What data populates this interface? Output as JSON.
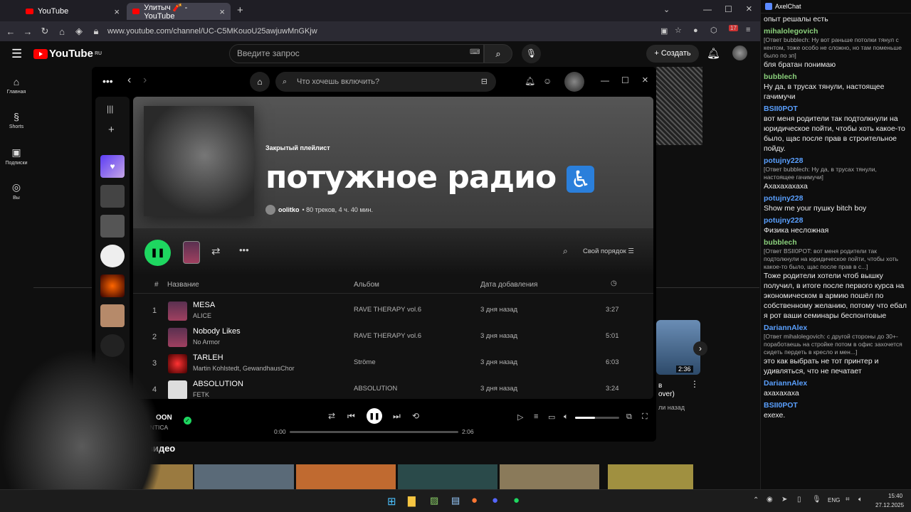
{
  "browser": {
    "tabs": [
      {
        "label": "YouTube"
      },
      {
        "label": "Улитыч 🧨 - YouTube"
      }
    ],
    "url": "www.youtube.com/channel/UC-C5MKouoU25awjuwMnGKjw",
    "notif_count": "17"
  },
  "youtube": {
    "logo": "YouTube",
    "region": "RU",
    "search_placeholder": "Введите запрос",
    "create_label": "Создать",
    "rail": [
      {
        "label": "Главная"
      },
      {
        "label": "Shorts"
      },
      {
        "label": "Подписки"
      },
      {
        "label": "Вы"
      }
    ],
    "section_fragment": "е видео",
    "video_time": "2:36",
    "video_text1": "в",
    "video_text2": "over)",
    "video_text3": "ли назад"
  },
  "spotify": {
    "search_placeholder": "Что хочешь включить?",
    "playlist_type": "Закрытый плейлист",
    "title": "потужное радио",
    "title_emoji": "♿",
    "owner": "oolitko",
    "meta": "• 80 треков, 4 ч. 40 мин.",
    "sort_label": "Свой порядок",
    "headers": {
      "num": "#",
      "title": "Название",
      "album": "Альбом",
      "date": "Дата добавления"
    },
    "tracks": [
      {
        "num": "1",
        "title": "MESA",
        "artist": "ALICE",
        "album": "RAVE THERAPY vol.6",
        "added": "3 дня назад",
        "duration": "3:27"
      },
      {
        "num": "2",
        "title": "Nobody Likes",
        "artist": "No Armor",
        "album": "RAVE THERAPY vol.6",
        "added": "3 дня назад",
        "duration": "5:01"
      },
      {
        "num": "3",
        "title": "TARLEH",
        "artist": "Martin Kohlstedt, GewandhausChor",
        "album": "Ströme",
        "added": "3 дня назад",
        "duration": "6:03"
      },
      {
        "num": "4",
        "title": "ABSOLUTION",
        "artist": "FETK",
        "album": "ABSOLUTION",
        "added": "3 дня назад",
        "duration": "3:24"
      }
    ],
    "now_playing": {
      "title": "OON",
      "artist": "ANTICA",
      "elapsed": "0:00",
      "total": "2:06"
    }
  },
  "chat": {
    "app": "AxelChat",
    "messages": [
      {
        "nick": "",
        "text": "опыт решалы есть",
        "reply": ""
      },
      {
        "nick": "mihalolegovich",
        "text": "бля братан понимаю",
        "reply": "[Ответ bubblech: Ну вот раньше потолки тянул с кентом, тоже особо не сложно, но там поменьше было по зп]"
      },
      {
        "nick": "bubblech",
        "text": "Ну да, в трусах тянули, настоящее гачимучи",
        "reply": ""
      },
      {
        "nick": "BSII0POT",
        "text": "вот меня родители так подтолкнули на юридическое пойти, чтобы хоть какое-то было, щас после прав в строительное пойду.",
        "reply": ""
      },
      {
        "nick": "potujny228",
        "text": "Ахахахахаха",
        "reply": "[Ответ bubblech: Ну да, в трусах тянули, настоящее гачимучи]"
      },
      {
        "nick": "potujny228",
        "text": "Show me your пушку bitch boy",
        "reply": ""
      },
      {
        "nick": "potujny228",
        "text": "Физика несложная",
        "reply": ""
      },
      {
        "nick": "bubblech",
        "text": "Тоже родители хотели чтоб вышку получил, в итоге после первого курса на экономическом в армию пошёл по собственному желанию, потому что ебал я рот ваши семинары беспонтовые",
        "reply": "[Ответ BSII0POT: вот меня родители так подтолкнули на юридическое пойти, чтобы хоть какое-то было, щас после прав в с...]"
      },
      {
        "nick": "DariannAlex",
        "text": "это как выбрать не тот принтер и удивляться, что не печатает",
        "reply": "[Ответ mihalolegovich: с другой стороны до 30+- поработаешь на стройке потом в офис захочется сидеть пердеть в кресло и мен...]"
      },
      {
        "nick": "DariannAlex",
        "text": "ахахахаха",
        "reply": ""
      },
      {
        "nick": "BSII0POT",
        "text": "ехехе.",
        "reply": ""
      }
    ]
  },
  "taskbar": {
    "lang": "ENG",
    "time": "15:40",
    "date": "27.12.2025"
  }
}
